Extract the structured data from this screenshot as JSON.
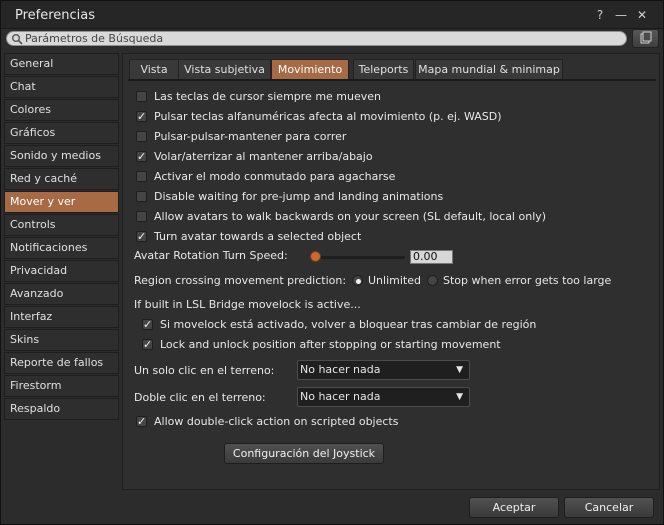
{
  "window": {
    "title": "Preferencias",
    "help_glyph": "?",
    "minimize_glyph": "—",
    "close_glyph": "✕"
  },
  "search": {
    "placeholder": "Parámetros de Búsqueda"
  },
  "sidebar": {
    "items": [
      {
        "label": "General"
      },
      {
        "label": "Chat"
      },
      {
        "label": "Colores"
      },
      {
        "label": "Gráficos"
      },
      {
        "label": "Sonido y medios"
      },
      {
        "label": "Red y caché"
      },
      {
        "label": "Mover y ver",
        "active": true
      },
      {
        "label": "Controls"
      },
      {
        "label": "Notificaciones"
      },
      {
        "label": "Privacidad"
      },
      {
        "label": "Avanzado"
      },
      {
        "label": "Interfaz"
      },
      {
        "label": "Skins"
      },
      {
        "label": "Reporte de fallos"
      },
      {
        "label": "Firestorm"
      },
      {
        "label": "Respaldo"
      }
    ]
  },
  "tabs": [
    {
      "label": "Vista"
    },
    {
      "label": "Vista subjetiva"
    },
    {
      "label": "Movimiento",
      "active": true
    },
    {
      "label": "Teleports"
    },
    {
      "label": "Mapa mundial & minimap"
    }
  ],
  "options": {
    "cursor_keys": {
      "label": "Las teclas de cursor siempre me mueven",
      "checked": false
    },
    "wasd": {
      "label": "Pulsar teclas alfanuméricas afecta al movimiento (p. ej. WASD)",
      "checked": true
    },
    "double_tap_run": {
      "label": "Pulsar-pulsar-mantener para correr",
      "checked": false
    },
    "fly_land": {
      "label": "Volar/aterrizar al mantener arriba/abajo",
      "checked": true
    },
    "crouch_toggle": {
      "label": "Activar el modo conmutado para agacharse",
      "checked": false
    },
    "prejump": {
      "label": "Disable waiting for pre-jump and landing animations",
      "checked": false
    },
    "walk_backwards": {
      "label": "Allow avatars to walk backwards on your screen (SL default, local only)",
      "checked": false
    },
    "turn_avatar": {
      "label": "Turn avatar towards a selected object",
      "checked": true
    }
  },
  "rotation": {
    "label": "Avatar Rotation Turn Speed:",
    "value": "0.00"
  },
  "region_crossing": {
    "label": "Region crossing movement prediction:",
    "opt_unlimited": "Unlimited",
    "opt_stop": "Stop when error gets too large",
    "selected": "Unlimited"
  },
  "movelock": {
    "heading": "If built in LSL Bridge movelock is active...",
    "relock": {
      "label": "Si movelock está activado, volver a bloquear tras cambiar de región",
      "checked": true
    },
    "lock_unlock": {
      "label": "Lock and unlock position after stopping or starting movement",
      "checked": true
    }
  },
  "single_click": {
    "label": "Un solo clic en el terreno:",
    "value": "No hacer nada"
  },
  "double_click": {
    "label": "Doble clic en el terreno:",
    "value": "No hacer nada"
  },
  "scripted_double_click": {
    "label": "Allow double-click action on scripted objects",
    "checked": true
  },
  "buttons": {
    "joystick": "Configuración del Joystick",
    "accept": "Aceptar",
    "cancel": "Cancelar"
  },
  "colors": {
    "accent": "#a86a45",
    "slider_thumb": "#c86a32"
  }
}
